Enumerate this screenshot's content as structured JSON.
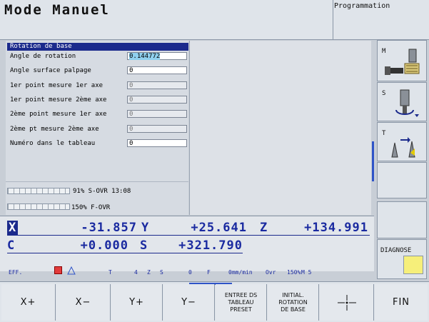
{
  "header": {
    "mode_title": "Mode Manuel",
    "programming_label": "Programmation"
  },
  "dialog": {
    "title": "Rotation de base",
    "fields": [
      {
        "label": "Angle de rotation",
        "value": "0.144772",
        "active": true,
        "disabled": false
      },
      {
        "label": "Angle surface palpage",
        "value": "0",
        "active": false,
        "disabled": false
      },
      {
        "label": "1er point mesure 1er axe",
        "value": "0",
        "active": false,
        "disabled": true
      },
      {
        "label": "1er point mesure 2ème axe",
        "value": "0",
        "active": false,
        "disabled": true
      },
      {
        "label": "2ème point mesure 1er axe",
        "value": "0",
        "active": false,
        "disabled": true
      },
      {
        "label": "2ème pt mesure 2ème axe",
        "value": "0",
        "active": false,
        "disabled": true
      },
      {
        "label": "Numéro dans le tableau",
        "value": "0",
        "active": false,
        "disabled": false
      }
    ]
  },
  "status": {
    "s_ovr": "91% S-OVR 13:08",
    "f_ovr": "150% F-OVR"
  },
  "position": {
    "x_label": "X",
    "x_value": "-31.857",
    "y_label": "Y",
    "y_value": "+25.641",
    "z_label": "Z",
    "z_value": "+134.991",
    "c_label": "C",
    "c_value": "+0.000",
    "s_label": "S",
    "s_value": "+321.790",
    "eff": "EFF.",
    "t_label": "T",
    "t_value": "4",
    "z2_label": "Z",
    "s2_label": "S",
    "s2_value": "0",
    "f_label": "F",
    "f_value": "0mm/min",
    "ovr_label": "Ovr",
    "ovr_value": "150%",
    "m_value": "M 5"
  },
  "vertical_softkeys": {
    "m_label": "M",
    "s_label": "S",
    "t_label": "T",
    "diagnose_label": "DIAGNOSE"
  },
  "softkeys": {
    "x_plus": "X+",
    "x_minus": "X−",
    "y_plus": "Y+",
    "y_minus": "Y−",
    "entree": "ENTREE DS\nTABLEAU\nPRESET",
    "initial": "INITIAL.\nROTATION\nDE BASE",
    "fin": "FIN"
  },
  "colors": {
    "accent": "#1b2a8c",
    "axis_text": "#1a2aa0",
    "highlight": "#8fd0ee"
  }
}
